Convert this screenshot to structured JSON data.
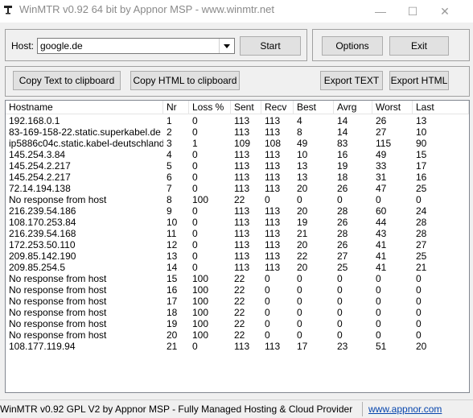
{
  "window": {
    "title": "WinMTR v0.92 64 bit by Appnor MSP - www.winmtr.net",
    "minimize_glyph": "—",
    "maximize_glyph": "☐",
    "close_glyph": "✕"
  },
  "host_panel": {
    "host_label": "Host:",
    "host_value": "google.de",
    "start_label": "Start"
  },
  "options_panel": {
    "options_label": "Options",
    "exit_label": "Exit"
  },
  "export_panel": {
    "copy_text_label": "Copy Text to clipboard",
    "copy_html_label": "Copy HTML to clipboard",
    "export_text_label": "Export TEXT",
    "export_html_label": "Export HTML"
  },
  "table": {
    "columns": [
      "Hostname",
      "Nr",
      "Loss %",
      "Sent",
      "Recv",
      "Best",
      "Avrg",
      "Worst",
      "Last"
    ],
    "rows": [
      [
        "192.168.0.1",
        "1",
        "0",
        "113",
        "113",
        "4",
        "14",
        "26",
        "13"
      ],
      [
        "83-169-158-22.static.superkabel.de",
        "2",
        "0",
        "113",
        "113",
        "8",
        "14",
        "27",
        "10"
      ],
      [
        "ip5886c04c.static.kabel-deutschland...",
        "3",
        "1",
        "109",
        "108",
        "49",
        "83",
        "115",
        "90"
      ],
      [
        "145.254.3.84",
        "4",
        "0",
        "113",
        "113",
        "10",
        "16",
        "49",
        "15"
      ],
      [
        "145.254.2.217",
        "5",
        "0",
        "113",
        "113",
        "13",
        "19",
        "33",
        "17"
      ],
      [
        "145.254.2.217",
        "6",
        "0",
        "113",
        "113",
        "13",
        "18",
        "31",
        "16"
      ],
      [
        "72.14.194.138",
        "7",
        "0",
        "113",
        "113",
        "20",
        "26",
        "47",
        "25"
      ],
      [
        "No response from host",
        "8",
        "100",
        "22",
        "0",
        "0",
        "0",
        "0",
        "0"
      ],
      [
        "216.239.54.186",
        "9",
        "0",
        "113",
        "113",
        "20",
        "28",
        "60",
        "24"
      ],
      [
        "108.170.253.84",
        "10",
        "0",
        "113",
        "113",
        "19",
        "26",
        "44",
        "28"
      ],
      [
        "216.239.54.168",
        "11",
        "0",
        "113",
        "113",
        "21",
        "28",
        "43",
        "28"
      ],
      [
        "172.253.50.110",
        "12",
        "0",
        "113",
        "113",
        "20",
        "26",
        "41",
        "27"
      ],
      [
        "209.85.142.190",
        "13",
        "0",
        "113",
        "113",
        "22",
        "27",
        "41",
        "25"
      ],
      [
        "209.85.254.5",
        "14",
        "0",
        "113",
        "113",
        "20",
        "25",
        "41",
        "21"
      ],
      [
        "No response from host",
        "15",
        "100",
        "22",
        "0",
        "0",
        "0",
        "0",
        "0"
      ],
      [
        "No response from host",
        "16",
        "100",
        "22",
        "0",
        "0",
        "0",
        "0",
        "0"
      ],
      [
        "No response from host",
        "17",
        "100",
        "22",
        "0",
        "0",
        "0",
        "0",
        "0"
      ],
      [
        "No response from host",
        "18",
        "100",
        "22",
        "0",
        "0",
        "0",
        "0",
        "0"
      ],
      [
        "No response from host",
        "19",
        "100",
        "22",
        "0",
        "0",
        "0",
        "0",
        "0"
      ],
      [
        "No response from host",
        "20",
        "100",
        "22",
        "0",
        "0",
        "0",
        "0",
        "0"
      ],
      [
        "108.177.119.94",
        "21",
        "0",
        "113",
        "113",
        "17",
        "23",
        "51",
        "20"
      ]
    ]
  },
  "statusbar": {
    "text": "WinMTR v0.92 GPL V2 by Appnor MSP - Fully Managed Hosting & Cloud Provider",
    "link": "www.appnor.com"
  },
  "icons": {
    "app": "network-tower-icon",
    "dropdown": "chevron-down-icon"
  }
}
